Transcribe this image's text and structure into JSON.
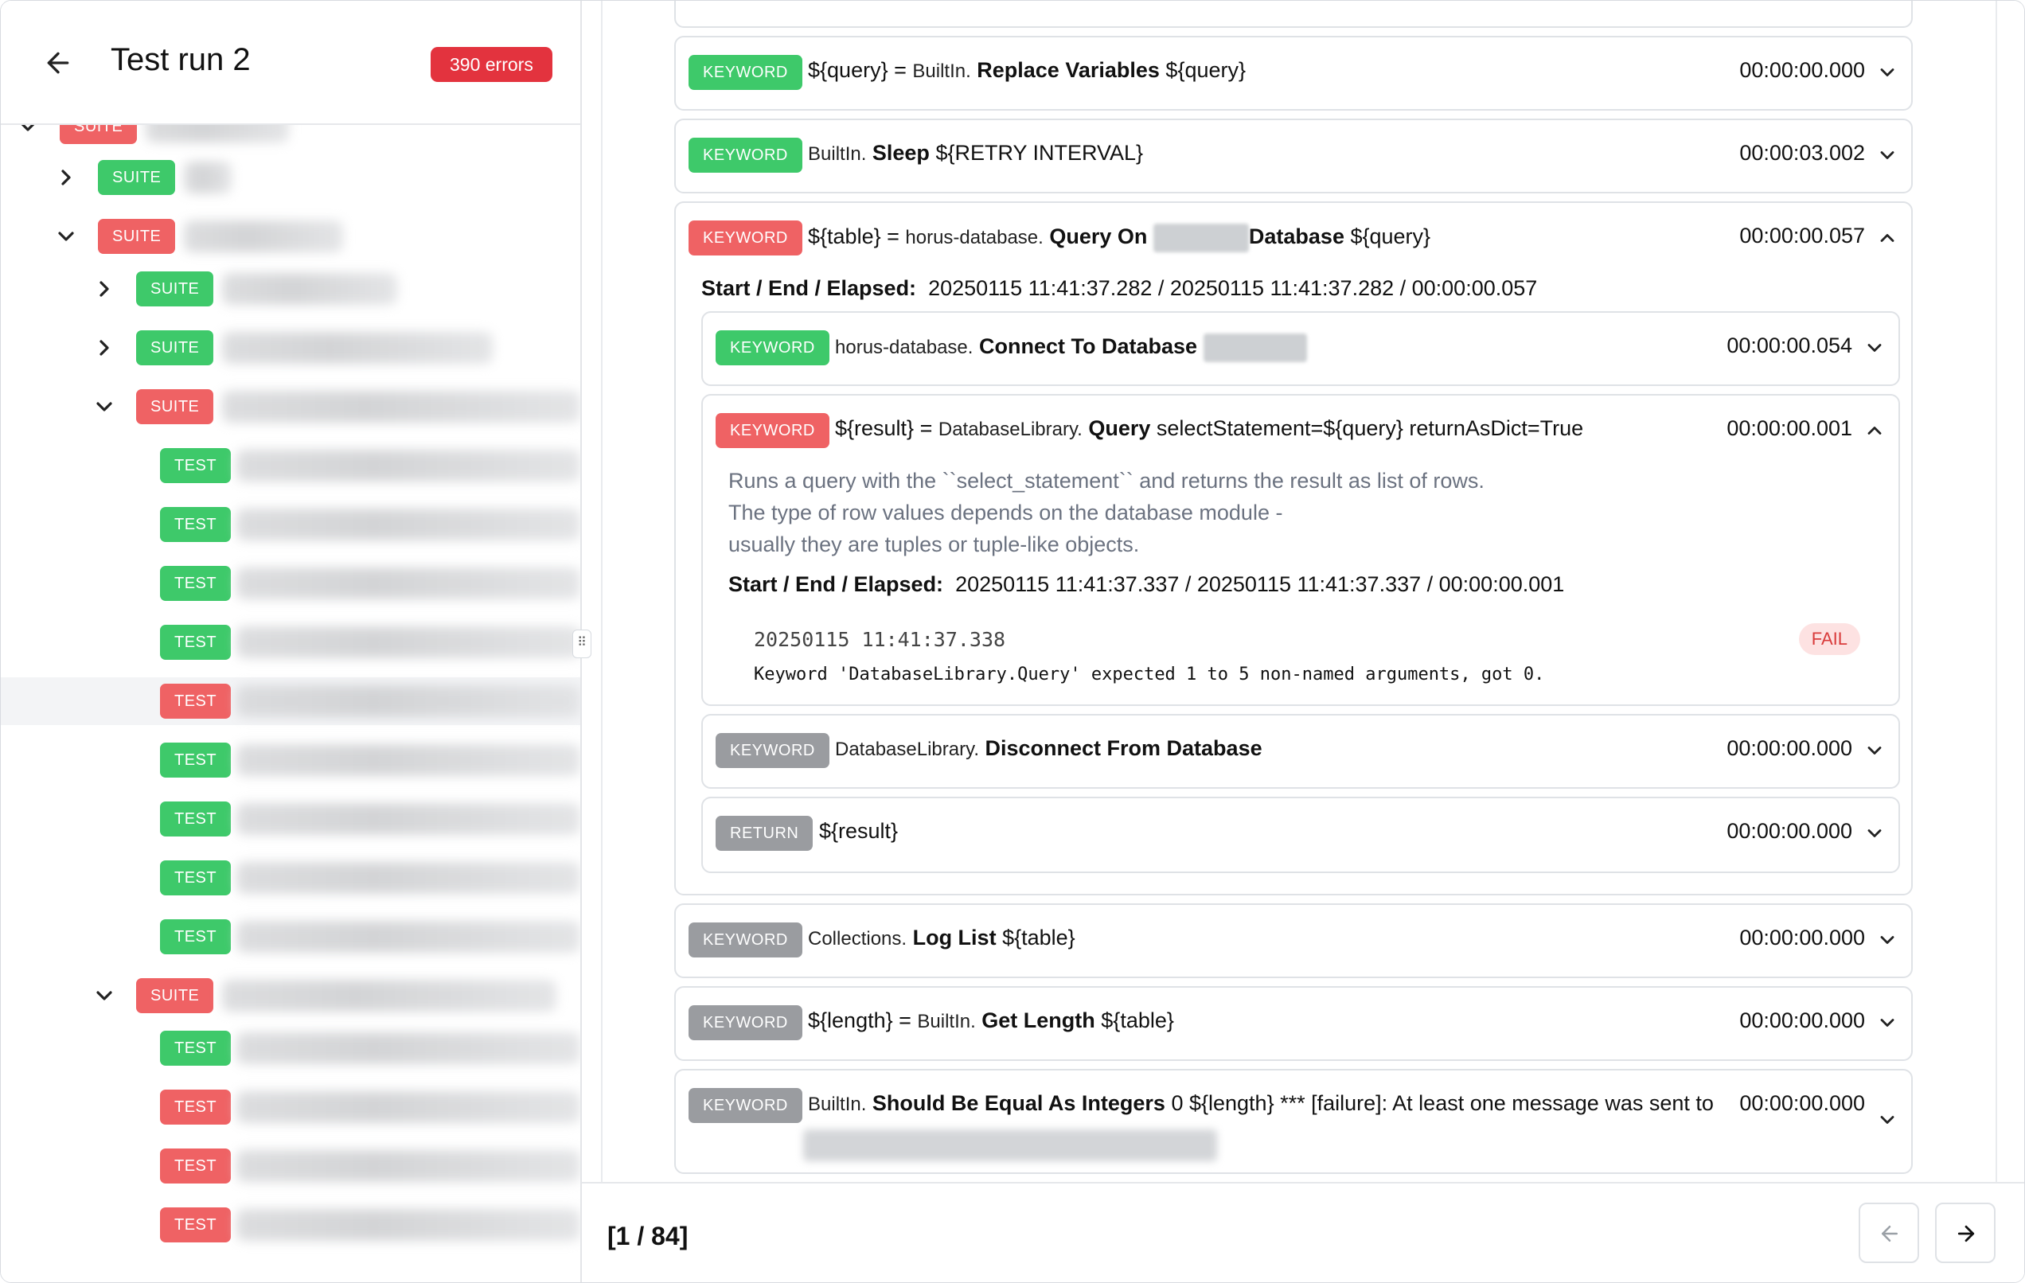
{
  "sidebar": {
    "title": "Test run 2",
    "error_badge": "390 errors",
    "tree": [
      {
        "type": "SUITE",
        "status": "fail",
        "indent": 0,
        "chevron": "down"
      },
      {
        "type": "SUITE",
        "status": "pass",
        "indent": 1,
        "chevron": "right"
      },
      {
        "type": "SUITE",
        "status": "fail",
        "indent": 1,
        "chevron": "down"
      },
      {
        "type": "SUITE",
        "status": "pass",
        "indent": 2,
        "chevron": "right"
      },
      {
        "type": "SUITE",
        "status": "pass",
        "indent": 2,
        "chevron": "right"
      },
      {
        "type": "SUITE",
        "status": "fail",
        "indent": 2,
        "chevron": "down"
      },
      {
        "type": "TEST",
        "status": "pass",
        "indent": 3
      },
      {
        "type": "TEST",
        "status": "pass",
        "indent": 3
      },
      {
        "type": "TEST",
        "status": "pass",
        "indent": 3
      },
      {
        "type": "TEST",
        "status": "pass",
        "indent": 3
      },
      {
        "type": "TEST",
        "status": "fail",
        "indent": 3,
        "selected": true
      },
      {
        "type": "TEST",
        "status": "pass",
        "indent": 3
      },
      {
        "type": "TEST",
        "status": "pass",
        "indent": 3
      },
      {
        "type": "TEST",
        "status": "pass",
        "indent": 3
      },
      {
        "type": "TEST",
        "status": "pass",
        "indent": 3
      },
      {
        "type": "SUITE",
        "status": "fail",
        "indent": 2,
        "chevron": "down"
      },
      {
        "type": "TEST",
        "status": "pass",
        "indent": 3
      },
      {
        "type": "TEST",
        "status": "fail",
        "indent": 3
      },
      {
        "type": "TEST",
        "status": "fail",
        "indent": 3
      },
      {
        "type": "TEST",
        "status": "fail",
        "indent": 3
      }
    ]
  },
  "keywords": {
    "replace": {
      "badge": "KEYWORD",
      "assign": "${query} = ",
      "lib": "BuiltIn.",
      "name": "Replace Variables",
      "args": " ${query}",
      "time": "00:00:00.000"
    },
    "sleep": {
      "badge": "KEYWORD",
      "lib": "BuiltIn.",
      "name": "Sleep",
      "args": " ${RETRY INTERVAL}",
      "time": "00:00:03.002"
    },
    "query_on": {
      "badge": "KEYWORD",
      "assign": "${table} = ",
      "lib": "horus-database.",
      "name": "Query On",
      "name2": "Database",
      "args": " ${query}",
      "time": "00:00:00.057",
      "meta_label": "Start / End / Elapsed:",
      "meta_value": "20250115 11:41:37.282 / 20250115 11:41:37.282 / 00:00:00.057"
    },
    "connect": {
      "badge": "KEYWORD",
      "lib": "horus-database.",
      "name": "Connect To Database",
      "time": "00:00:00.054"
    },
    "query": {
      "badge": "KEYWORD",
      "assign": "${result} = ",
      "lib": "DatabaseLibrary.",
      "name": "Query",
      "args": " selectStatement=${query} returnAsDict=True",
      "time": "00:00:00.001",
      "doc1": "Runs a query with the ``select_statement`` and returns the result as list of rows.",
      "doc2": "The type of row values depends on the database module -",
      "doc3": "usually they are tuples or tuple-like objects.",
      "meta_label": "Start / End / Elapsed:",
      "meta_value": "20250115 11:41:37.337 / 20250115 11:41:37.337 / 00:00:00.001",
      "log_time": "20250115 11:41:37.338",
      "log_msg": "Keyword 'DatabaseLibrary.Query' expected 1 to 5 non-named arguments, got 0.",
      "log_level": "FAIL"
    },
    "disconnect": {
      "badge": "KEYWORD",
      "lib": "DatabaseLibrary.",
      "name": "Disconnect From Database",
      "time": "00:00:00.000"
    },
    "return": {
      "badge": "RETURN",
      "args": "${result}",
      "time": "00:00:00.000"
    },
    "loglist": {
      "badge": "KEYWORD",
      "lib": "Collections.",
      "name": "Log List",
      "args": " ${table}",
      "time": "00:00:00.000"
    },
    "getlength": {
      "badge": "KEYWORD",
      "assign": "${length} = ",
      "lib": "BuiltIn.",
      "name": "Get Length",
      "args": " ${table}",
      "time": "00:00:00.000"
    },
    "shouldequal": {
      "badge": "KEYWORD",
      "lib": "BuiltIn.",
      "name": "Should Be Equal As Integers",
      "args": " 0 ${length} *** [failure]: At least one message was sent to",
      "time": "00:00:00.000"
    }
  },
  "footer": {
    "pager": "[1 / 84]"
  },
  "colors": {
    "pass": "#3ec96a",
    "fail": "#ef6264",
    "neutral": "#9a9ca0",
    "error_badge": "#e3333e"
  }
}
